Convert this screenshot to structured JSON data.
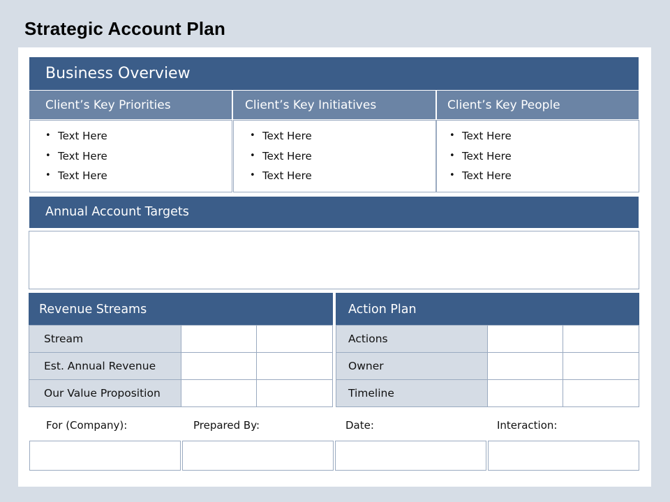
{
  "page": {
    "title": "Strategic Account Plan"
  },
  "business_overview": {
    "header": "Business Overview",
    "columns": [
      {
        "label": "Client’s Key Priorities",
        "items": [
          "Text Here",
          "Text Here",
          "Text Here"
        ]
      },
      {
        "label": "Client’s Key Initiatives",
        "items": [
          "Text Here",
          "Text Here",
          "Text Here"
        ]
      },
      {
        "label": "Client’s Key People",
        "items": [
          "Text Here",
          "Text Here",
          "Text Here"
        ]
      }
    ]
  },
  "annual_targets": {
    "header": "Annual Account Targets",
    "value": ""
  },
  "revenue_streams": {
    "header": "Revenue Streams",
    "rows": [
      {
        "label": "Stream",
        "cells": [
          "",
          ""
        ]
      },
      {
        "label": "Est. Annual Revenue",
        "cells": [
          "",
          ""
        ]
      },
      {
        "label": "Our Value Proposition",
        "cells": [
          "",
          ""
        ]
      }
    ]
  },
  "action_plan": {
    "header": "Action Plan",
    "rows": [
      {
        "label": "Actions",
        "cells": [
          "",
          ""
        ]
      },
      {
        "label": "Owner",
        "cells": [
          "",
          ""
        ]
      },
      {
        "label": "Timeline",
        "cells": [
          "",
          ""
        ]
      }
    ]
  },
  "footer": {
    "fields": [
      {
        "label": "For (Company):",
        "value": ""
      },
      {
        "label": "Prepared By:",
        "value": ""
      },
      {
        "label": "Date:",
        "value": ""
      },
      {
        "label": "Interaction:",
        "value": ""
      }
    ]
  },
  "colors": {
    "header_bar": "#3b5d89",
    "sub_header": "#6b84a5",
    "label_cell": "#d5dce5",
    "background": "#d6dde6"
  }
}
